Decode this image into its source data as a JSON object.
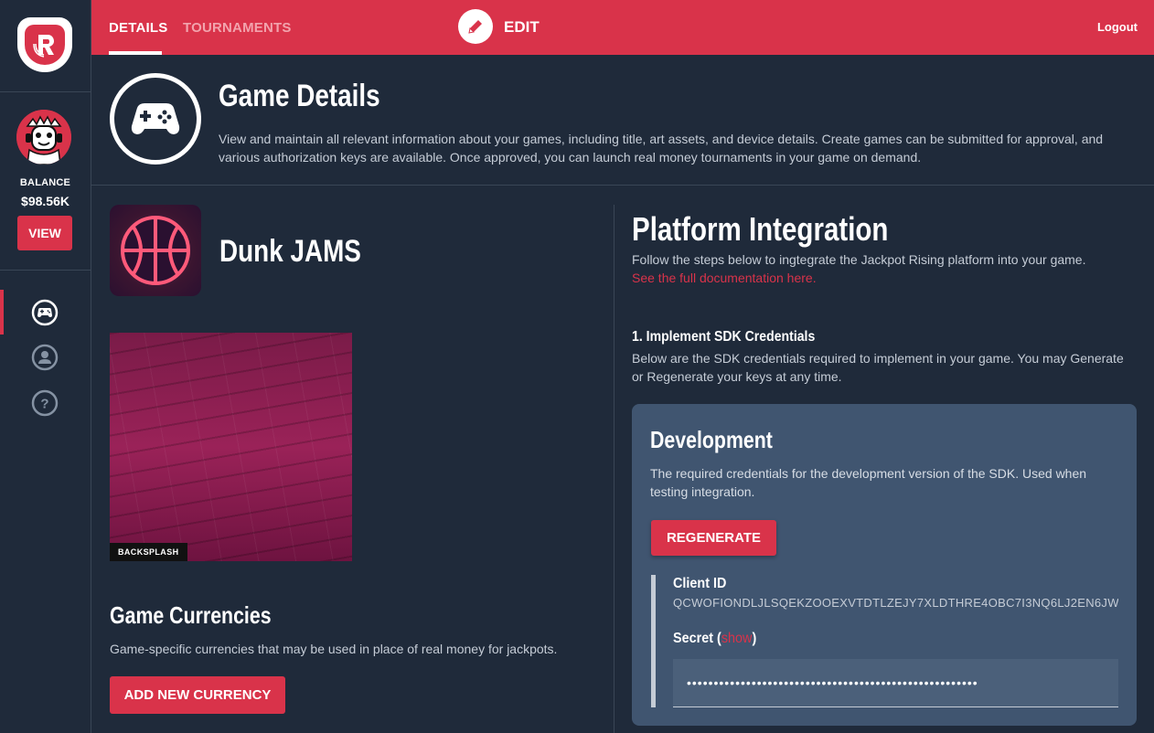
{
  "sidebar": {
    "balance_label": "BALANCE",
    "balance_value": "$98.56K",
    "view_label": "VIEW",
    "nav": [
      {
        "icon": "gamepad-icon",
        "active": true
      },
      {
        "icon": "user-icon",
        "active": false
      },
      {
        "icon": "help-icon",
        "active": false
      }
    ]
  },
  "topbar": {
    "tabs": [
      {
        "label": "DETAILS",
        "active": true
      },
      {
        "label": "TOURNAMENTS",
        "active": false
      }
    ],
    "edit_label": "EDIT",
    "logout_label": "Logout"
  },
  "header": {
    "title": "Game Details",
    "description": "View and maintain all relevant information about your games, including title, art assets, and device details. Create games can be submitted for approval, and various authorization keys are available. Once approved, you can launch real money tournaments in your game on demand."
  },
  "game": {
    "name": "Dunk JAMS",
    "backsplash_tag": "BACKSPLASH",
    "currencies_title": "Game Currencies",
    "currencies_description": "Game-specific currencies that may be used in place of real money for jackpots.",
    "add_currency_label": "ADD NEW CURRENCY"
  },
  "platform": {
    "title": "Platform Integration",
    "description": "Follow the steps below to ingtegrate the Jackpot Rising platform into your game.",
    "doc_link": "See the full documentation here.",
    "sdk_title": "1. Implement SDK Credentials",
    "sdk_description": "Below are the SDK credentials required to implement in your game. You may Generate or Regenerate your keys at any time."
  },
  "development": {
    "title": "Development",
    "description": "The required credentials for the development version of the SDK. Used when testing integration.",
    "regenerate_label": "REGENERATE",
    "client_id_label": "Client ID",
    "client_id_value": "QCWOFIONDLJLSQEKZOOEXVTDTLZEJY7XLDTHRE4OBC7I3NQ6LJ2EN6JW",
    "secret_label": "Secret",
    "secret_show": "show",
    "secret_value": "••••••••••••••••••••••••••••••••••••••••••••••••••••••"
  },
  "colors": {
    "accent": "#d9334a",
    "background": "#1f2a3a",
    "card": "#405570"
  }
}
